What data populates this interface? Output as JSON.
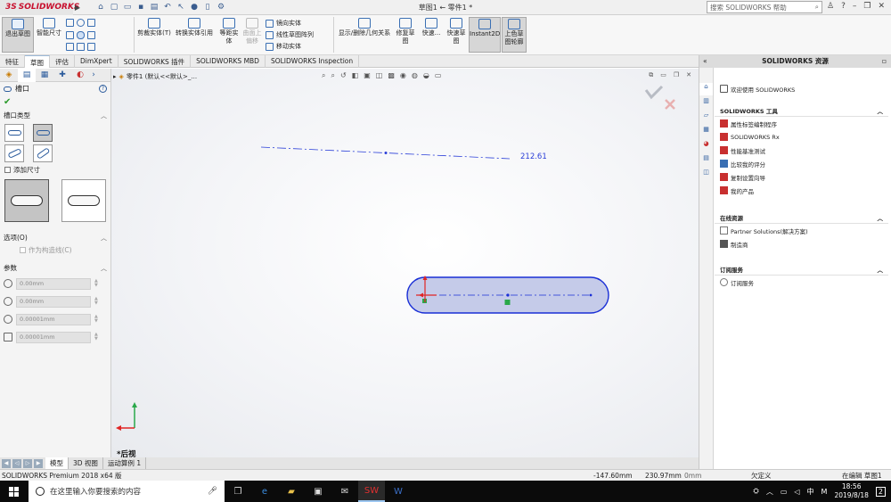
{
  "app": {
    "logo_text": "SOLIDWORKS",
    "document_title": "草图1 ← 零件1 *",
    "search_placeholder": "搜索 SOLIDWORKS 帮助"
  },
  "ribbon": {
    "exit_sketch": "退出草图",
    "smart_dimension": "智能尺寸",
    "trim_entities": "剪裁实体(T)",
    "convert_entities": "转换实体引用",
    "offset_entities": "等距实体",
    "offset_on_surface": "曲面上偏移",
    "mirror_entities": "镜向实体",
    "linear_pattern": "线性草图阵列",
    "move_entities": "移动实体",
    "display_relations": "显示/删除几何关系",
    "repair_sketch": "修复草图",
    "quick_snaps": "快速...",
    "rapid_sketch": "快速草图",
    "instant2d": "Instant2D",
    "shaded_contours": "上色草图轮廓"
  },
  "command_tabs": [
    "特征",
    "草图",
    "评估",
    "DimXpert",
    "SOLIDWORKS 插件",
    "SOLIDWORKS MBD",
    "SOLIDWORKS Inspection"
  ],
  "command_tab_active": 1,
  "property_manager": {
    "title": "槽口",
    "slot_type_label": "槽口类型",
    "add_dimensions": "添加尺寸",
    "options_label": "选项(O)",
    "construction_label": "作为构造线(C)",
    "params_label": "参数",
    "params": [
      "0.00mm",
      "0.00mm",
      "0.00001mm",
      "0.00001mm"
    ]
  },
  "canvas": {
    "tree_label": "零件1 (默认<<默认>_...",
    "dimension_text": "212.61",
    "view_label": "*后视"
  },
  "bottom_tabs": [
    "模型",
    "3D 视图",
    "运动算例 1"
  ],
  "bottom_tab_active": 0,
  "status": {
    "product": "SOLIDWORKS Premium 2018 x64 版",
    "x": "-147.60mm",
    "y": "230.97mm",
    "z": "0mm",
    "sketch_state": "欠定义",
    "units": "在编辑 草图1"
  },
  "task_pane": {
    "title": "SOLIDWORKS 资源",
    "welcome": "欢迎使用 SOLIDWORKS",
    "tools_heading": "SOLIDWORKS 工具",
    "tools": [
      "属性标签编制程序",
      "SOLIDWORKS Rx",
      "性能基准测试",
      "比较我的评分",
      "复制设置向导",
      "我的产品"
    ],
    "online_heading": "在线资源",
    "online": [
      "Partner Solutions(解决方案)",
      "制造商"
    ],
    "subscription_heading": "订阅服务",
    "subscription": [
      "订阅服务"
    ]
  },
  "taskbar": {
    "search_text": "在这里输入你要搜索的内容",
    "time": "18:56",
    "date": "2019/8/18",
    "notifications": "2"
  },
  "colors": {
    "slot_fill": "#c5cbe9",
    "slot_outline": "#1a2fd6",
    "accent_red": "#c8102e"
  }
}
